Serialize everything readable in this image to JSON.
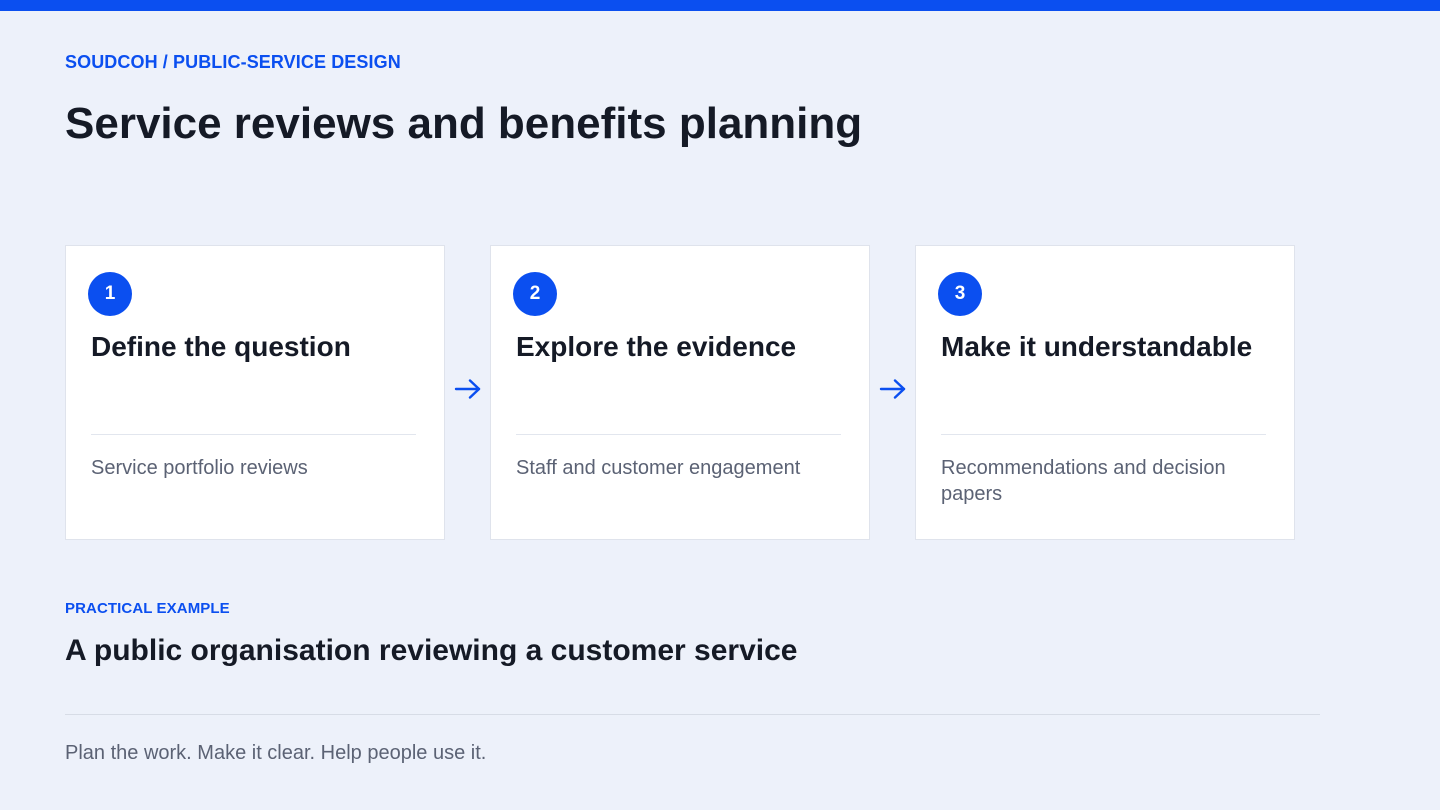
{
  "header": {
    "eyebrow": "SOUDCOH / PUBLIC-SERVICE DESIGN",
    "title": "Service reviews and benefits planning"
  },
  "steps": [
    {
      "number": "1",
      "title": "Define the question",
      "description": "Service portfolio reviews"
    },
    {
      "number": "2",
      "title": "Explore the evidence",
      "description": "Staff and customer engagement"
    },
    {
      "number": "3",
      "title": "Make it understandable",
      "description": "Recommendations and decision papers"
    }
  ],
  "example": {
    "label": "PRACTICAL EXAMPLE",
    "title": "A public organisation reviewing a customer service"
  },
  "footer": {
    "tagline": "Plan the work. Make it clear. Help people use it."
  },
  "icons": {
    "step_arrow": "arrow-right-icon"
  },
  "colors": {
    "accent": "#0b4ff0",
    "background": "#edf1fa",
    "card": "#ffffff",
    "text": "#151a26",
    "muted_text": "#5b6274"
  }
}
